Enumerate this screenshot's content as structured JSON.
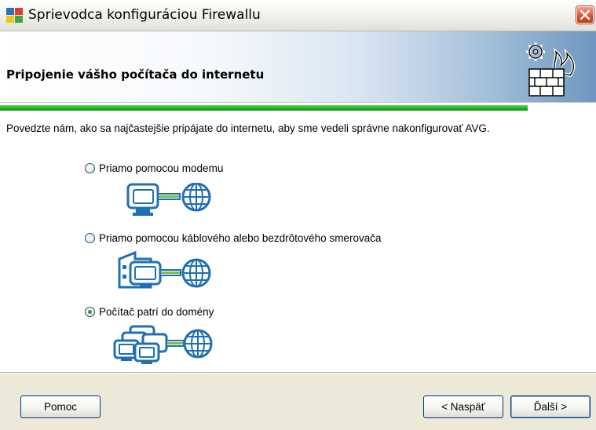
{
  "window": {
    "title": "Sprievodca konfiguráciou Firewallu",
    "app_icon": "avg-colored-blocks-icon",
    "close_icon": "close-icon"
  },
  "header": {
    "title": "Pripojenie vášho počítača do internetu",
    "icon": "firewall-gear-flame-icon",
    "progress_fraction": 0.885,
    "progress_color": "#22b822"
  },
  "main": {
    "intro": "Povedzte nám, ako sa najčastejšie pripájate do internetu, aby sme vedeli správne nakonfigurovať AVG.",
    "options": [
      {
        "label": "Priamo pomocou modemu",
        "checked": false,
        "icon": "monitor-globe-icon"
      },
      {
        "label": "Priamo pomocou káblového alebo bezdrôtového smerovača",
        "checked": false,
        "icon": "router-monitor-globe-icon"
      },
      {
        "label": "Počítač patrí do domény",
        "checked": true,
        "icon": "multiple-monitors-globe-icon"
      }
    ]
  },
  "footer": {
    "help_label": "Pomoc",
    "back_label": "< Naspäť",
    "next_label": "Ďalší >"
  },
  "colors": {
    "illustration_blue": "#1f6fb4",
    "connector_green": "#7dbf3a"
  }
}
